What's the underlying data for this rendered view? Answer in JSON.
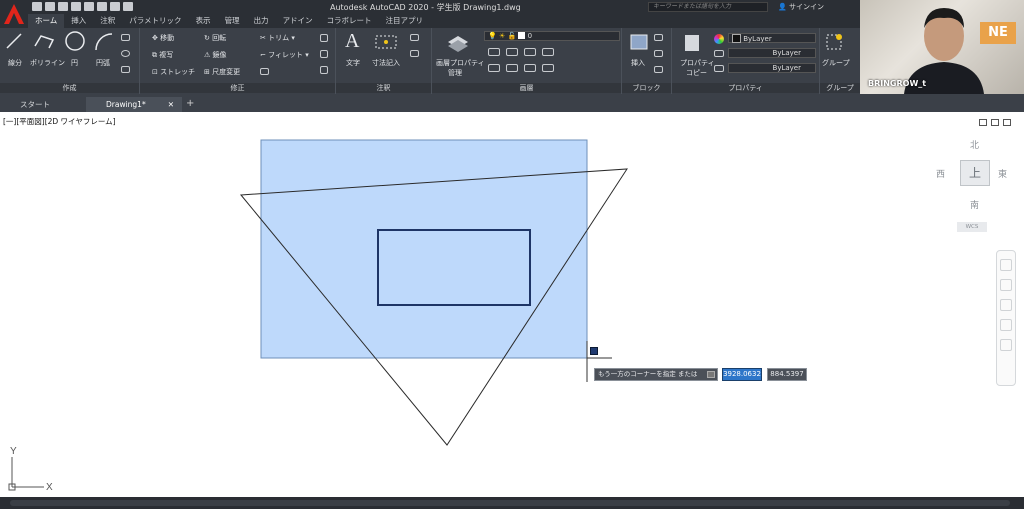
{
  "app": {
    "title": "Autodesk AutoCAD 2020 - 学生版    Drawing1.dwg",
    "search_placeholder": "キーワードまたは語句を入力",
    "signin_label": "サインイン",
    "logo_letter": "A"
  },
  "ribbon_tabs": [
    "ホーム",
    "挿入",
    "注釈",
    "パラメトリック",
    "表示",
    "管理",
    "出力",
    "アドイン",
    "コラボレート",
    "注目アプリ"
  ],
  "panels": {
    "draw": {
      "label": "作成",
      "tools": [
        "線分",
        "ポリライン",
        "円",
        "円弧"
      ]
    },
    "modify": {
      "label": "修正",
      "tools": [
        "移動",
        "回転",
        "トリム",
        "複写",
        "鏡像",
        "フィレット",
        "ストレッチ",
        "尺度変更"
      ]
    },
    "annotation": {
      "label": "注釈",
      "tools": [
        "文字",
        "寸法記入"
      ]
    },
    "layers": {
      "label": "画層",
      "tools": [
        "画層プロパティ",
        "管理"
      ],
      "current_layer": "0"
    },
    "block": {
      "label": "ブロック",
      "tools": [
        "挿入"
      ]
    },
    "properties": {
      "label": "プロパティ",
      "tools": [
        "プロパティ",
        "コピー"
      ],
      "color_value": "ByLayer",
      "linetype_value": "ByLayer",
      "lineweight_value": "ByLayer"
    },
    "groups": {
      "label": "グループ",
      "tools": [
        "グループ"
      ]
    }
  },
  "doc_tabs": [
    "スタート",
    "Drawing1*"
  ],
  "viewport": {
    "label": "[一][平面図][2D ワイヤフレーム]"
  },
  "viewcube": {
    "center": "上",
    "north": "北",
    "south": "南",
    "east": "東",
    "west": "西",
    "wcs": "WCS"
  },
  "command_prompt": {
    "text": "もう一方のコーナーを指定 または",
    "x_value": "3928.0632",
    "y_value": "884.5397"
  },
  "ucs": {
    "x_label": "X",
    "y_label": "Y"
  },
  "webcam": {
    "name": "BRINGROW_t",
    "sign_text": "NE"
  },
  "colors": {
    "selection_fill": "#bed9fb",
    "ribbon_bg": "#3b4048",
    "active_input": "#2e76c9"
  }
}
